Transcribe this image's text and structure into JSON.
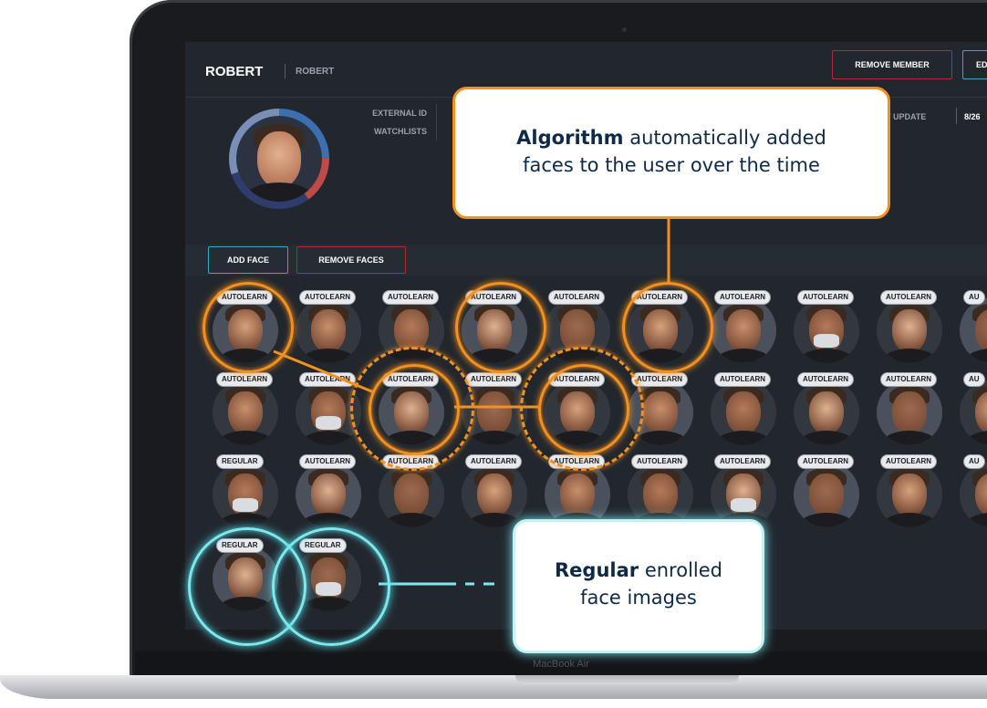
{
  "device": {
    "label": "MacBook Air"
  },
  "member": {
    "name": "ROBERT",
    "sub_name": "ROBERT"
  },
  "header_buttons": {
    "remove_member": "REMOVE MEMBER",
    "edit": "ED"
  },
  "meta": {
    "external_id_label": "EXTERNAL ID",
    "watchlists_label": "WATCHLISTS",
    "last_update_label": "T UPDATE",
    "last_update_value": "8/26"
  },
  "toolbar": {
    "add_face": "ADD FACE",
    "remove_faces": "REMOVE FACES"
  },
  "face_rows": [
    [
      "AUTOLEARN",
      "AUTOLEARN",
      "AUTOLEARN",
      "AUTOLEARN",
      "AUTOLEARN",
      "AUTOLEARN",
      "AUTOLEARN",
      "AUTOLEARN",
      "AUTOLEARN",
      "AU"
    ],
    [
      "AUTOLEARN",
      "AUTOLEARN",
      "AUTOLEARN",
      "AUTOLEARN",
      "AUTOLEARN",
      "AUTOLEARN",
      "AUTOLEARN",
      "AUTOLEARN",
      "AUTOLEARN",
      "AU"
    ],
    [
      "REGULAR",
      "AUTOLEARN",
      "AUTOLEARN",
      "AUTOLEARN",
      "AUTOLEARN",
      "AUTOLEARN",
      "AUTOLEARN",
      "AUTOLEARN",
      "AUTOLEARN",
      "AU"
    ],
    [
      "REGULAR",
      "REGULAR"
    ]
  ],
  "callouts": {
    "algorithm_bold": "Algorithm",
    "algorithm_rest_1": "automatically added",
    "algorithm_rest_2": "faces to the user over the time",
    "regular_bold": "Regular",
    "regular_rest_1": "enrolled",
    "regular_rest_2": "face images"
  },
  "colors": {
    "autolearn_highlight": "#f4901e",
    "regular_highlight": "#7ee8ee",
    "callout_text": "#0e2a47",
    "remove_red": "#b12a3a",
    "add_blue": "#3aa9c9"
  }
}
